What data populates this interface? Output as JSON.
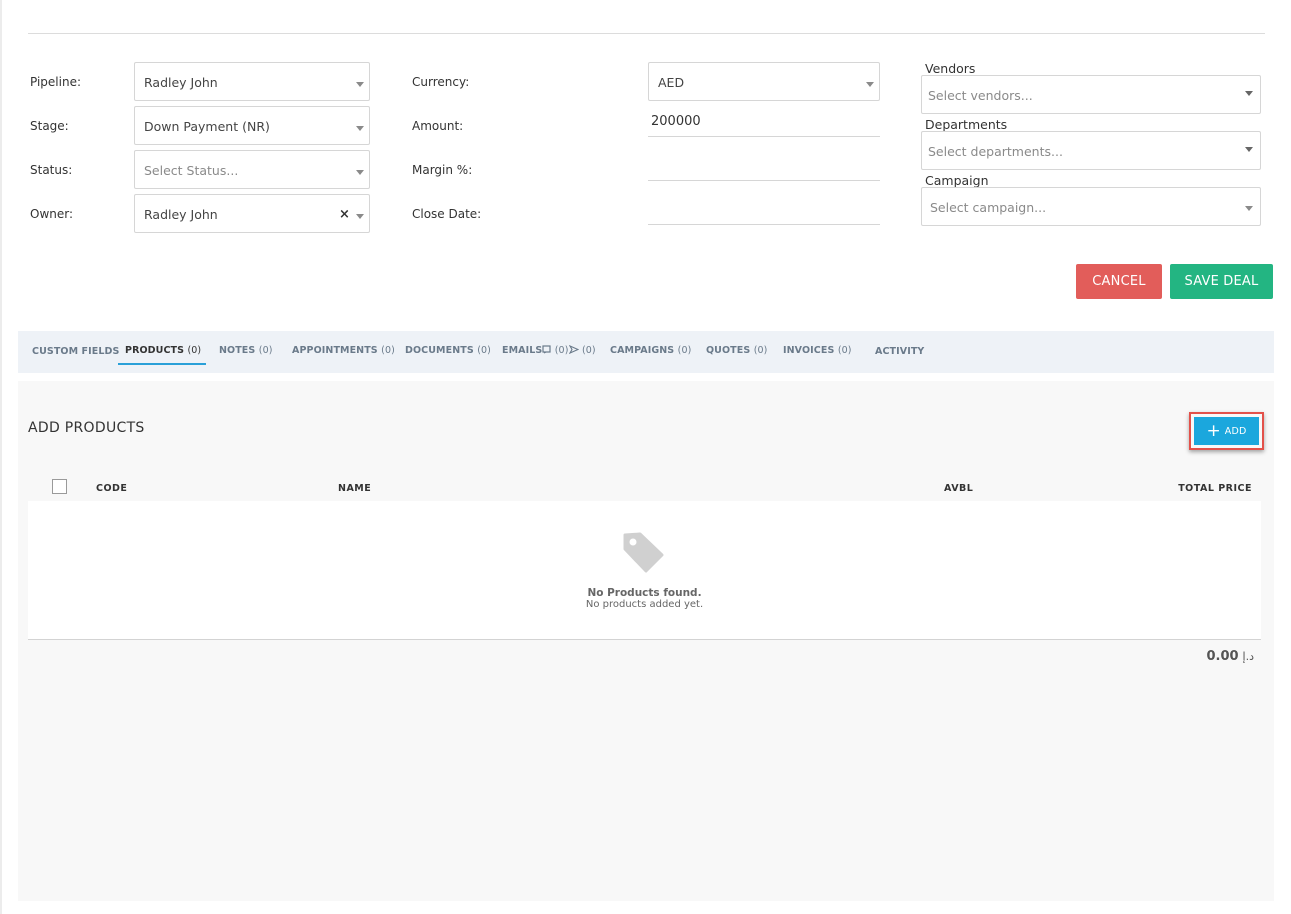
{
  "form": {
    "pipeline": {
      "label": "Pipeline:",
      "value": "Radley John"
    },
    "stage": {
      "label": "Stage:",
      "value": "Down Payment (NR)"
    },
    "status": {
      "label": "Status:",
      "placeholder": "Select Status..."
    },
    "owner": {
      "label": "Owner:",
      "value": "Radley John"
    },
    "currency": {
      "label": "Currency:",
      "value": "AED"
    },
    "amount": {
      "label": "Amount:",
      "value": "200000"
    },
    "margin": {
      "label": "Margin %:",
      "value": ""
    },
    "close_date": {
      "label": "Close Date:",
      "value": ""
    },
    "vendors": {
      "label": "Vendors",
      "placeholder": "Select vendors..."
    },
    "departments": {
      "label": "Departments",
      "placeholder": "Select departments..."
    },
    "campaign": {
      "label": "Campaign",
      "placeholder": "Select campaign..."
    }
  },
  "actions": {
    "cancel": "CANCEL",
    "save": "SAVE DEAL"
  },
  "tabs": [
    {
      "label": "CUSTOM FIELDS",
      "count": ""
    },
    {
      "label": "PRODUCTS",
      "count": "(0)"
    },
    {
      "label": "NOTES",
      "count": "(0)"
    },
    {
      "label": "APPOINTMENTS",
      "count": "(0)"
    },
    {
      "label": "DOCUMENTS",
      "count": "(0)"
    },
    {
      "label": "EMAILS",
      "count": "(0)",
      "count2": "(0)"
    },
    {
      "label": "CAMPAIGNS",
      "count": "(0)"
    },
    {
      "label": "QUOTES",
      "count": "(0)"
    },
    {
      "label": "INVOICES",
      "count": "(0)"
    },
    {
      "label": "ACTIVITY",
      "count": ""
    }
  ],
  "products": {
    "title": "ADD PRODUCTS",
    "add_label": "ADD",
    "columns": {
      "code": "CODE",
      "name": "NAME",
      "avbl": "AVBL",
      "total_price": "TOTAL PRICE"
    },
    "empty_title": "No Products found.",
    "empty_subtitle": "No products added yet.",
    "total_value": "0.00",
    "currency_symbol": "د.إ"
  },
  "colors": {
    "cancel": "#e25d5a",
    "save": "#23b582",
    "add": "#1ba7dd",
    "add_highlight": "#e3514a",
    "tab_active": "#2aa0d8"
  }
}
